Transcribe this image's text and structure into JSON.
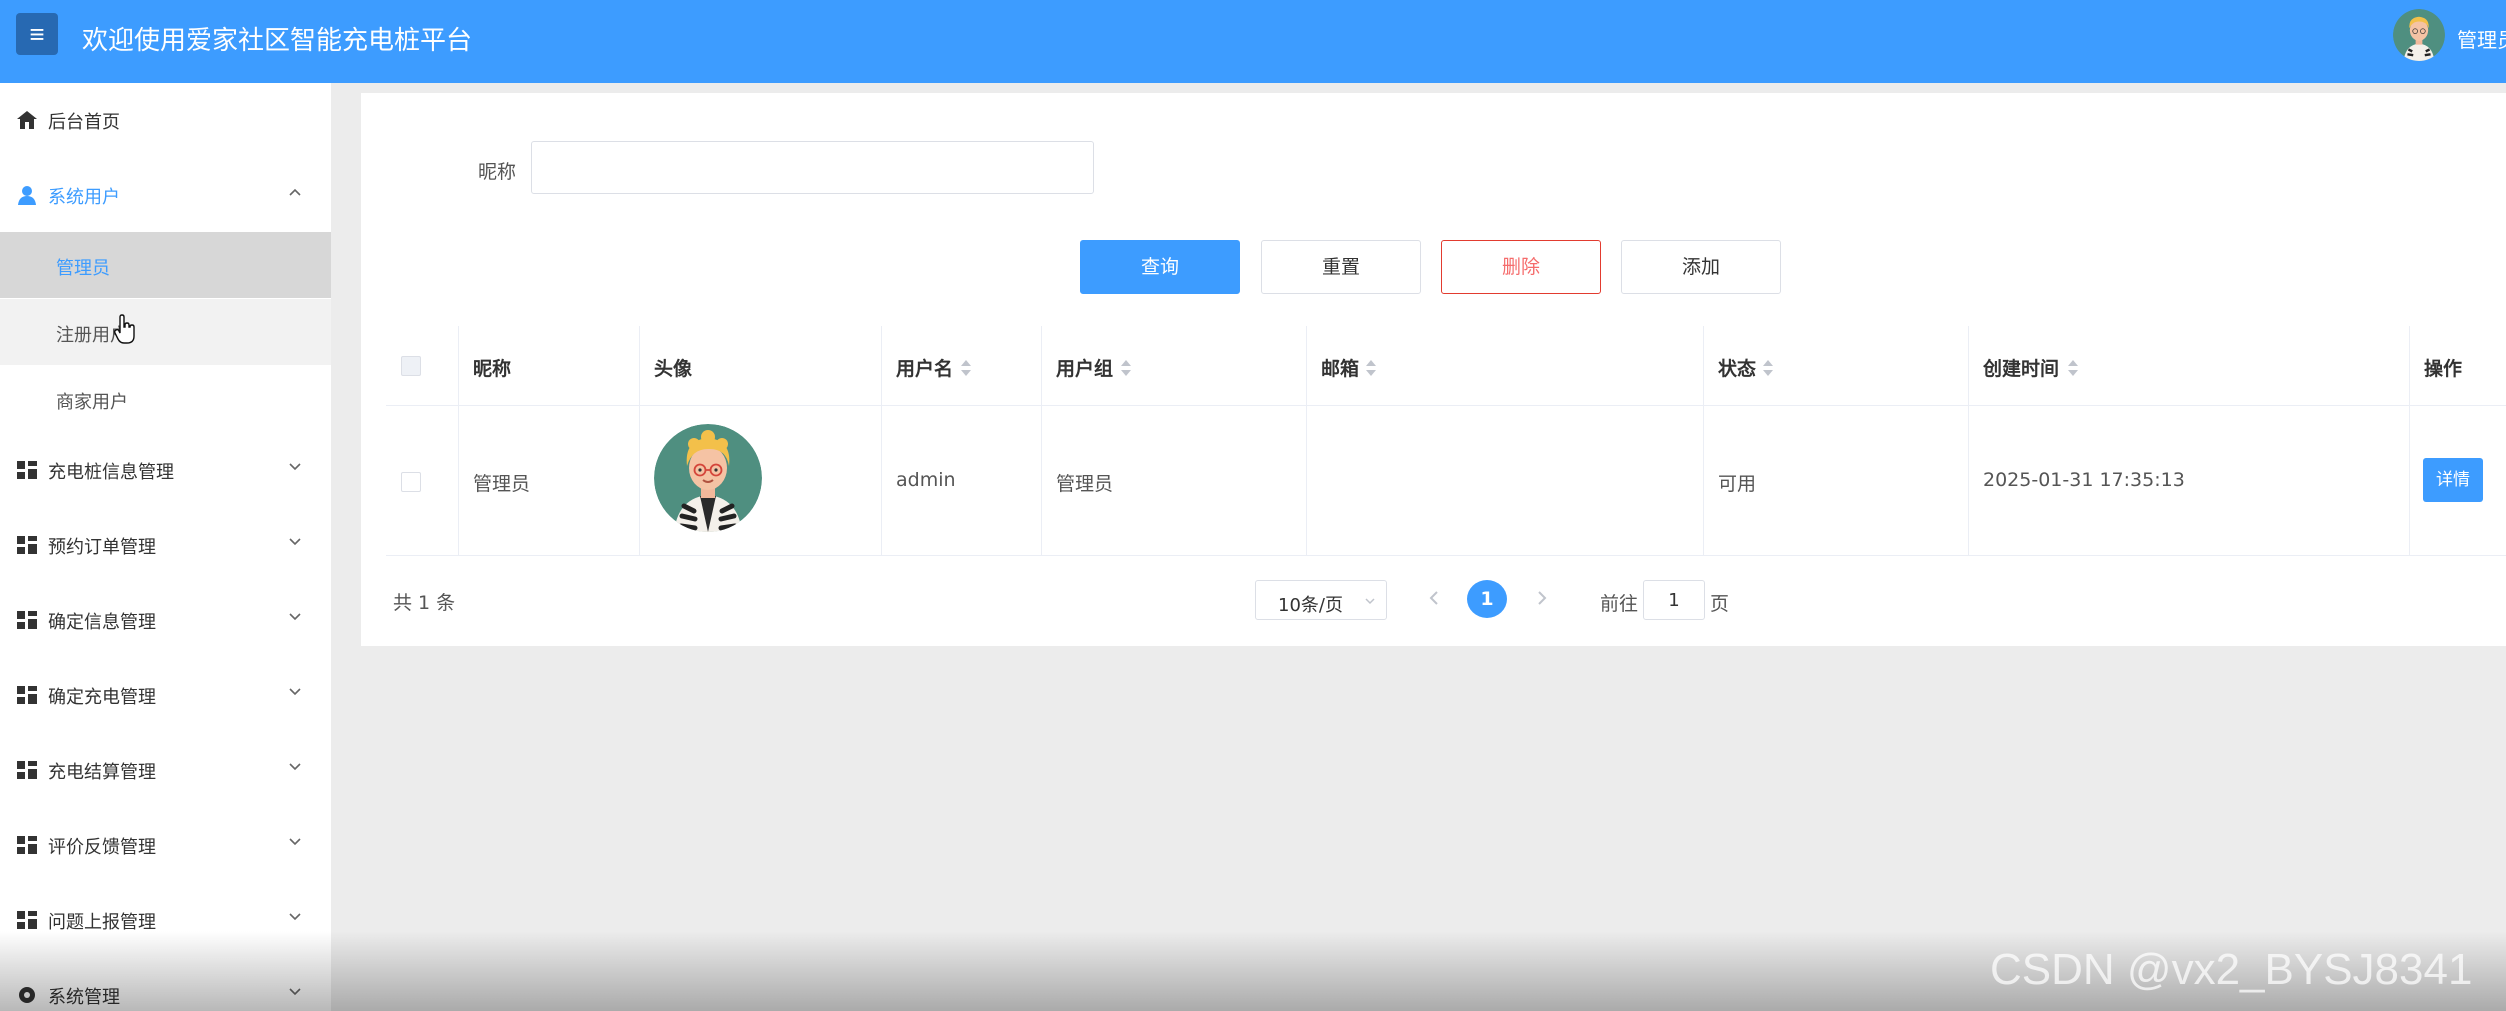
{
  "header": {
    "title": "欢迎使用爱家社区智能充电桩平台",
    "user_label": "管理员",
    "menu_icon": "hamburger-icon",
    "accent": "#3d9cff"
  },
  "sidebar": {
    "home": "后台首页",
    "system_users": "系统用户",
    "sub": {
      "admin": "管理员",
      "registered": "注册用户",
      "merchant": "商家用户"
    },
    "items": [
      "充电桩信息管理",
      "预约订单管理",
      "确定信息管理",
      "确定充电管理",
      "充电结算管理",
      "评价反馈管理",
      "问题上报管理",
      "系统管理"
    ]
  },
  "search": {
    "label": "昵称",
    "value": "",
    "placeholder": ""
  },
  "buttons": {
    "query": "查询",
    "reset": "重置",
    "delete": "删除",
    "add": "添加"
  },
  "table": {
    "headers": {
      "nickname": "昵称",
      "avatar": "头像",
      "username": "用户名",
      "group": "用户组",
      "email": "邮箱",
      "status": "状态",
      "created": "创建时间",
      "action": "操作"
    },
    "rows": [
      {
        "nickname": "管理员",
        "username": "admin",
        "group": "管理员",
        "email": "",
        "status": "可用",
        "created": "2025-01-31 17:35:13",
        "action": "详情"
      }
    ]
  },
  "pagination": {
    "total": "共 1 条",
    "page_size": "10条/页",
    "current": "1",
    "goto_label": "前往",
    "goto_value": "1",
    "goto_suffix": "页"
  },
  "watermark": "CSDN @vx2_BYSJ8341"
}
